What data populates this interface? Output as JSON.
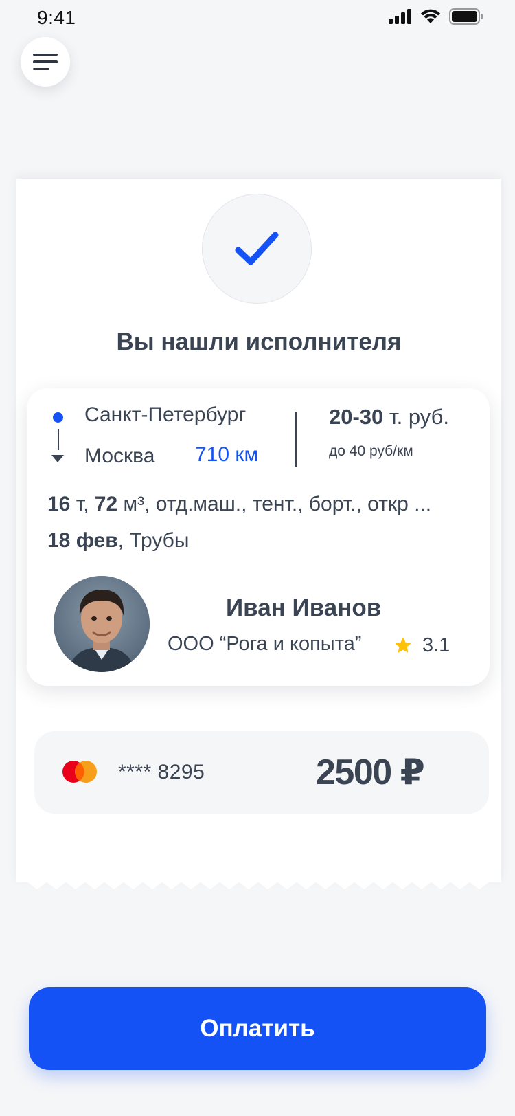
{
  "status_bar": {
    "time": "9:41"
  },
  "receipt": {
    "title": "Вы нашли исполнителя",
    "route": {
      "from": "Санкт-Петербург",
      "to": "Москва",
      "distance": "710 км"
    },
    "price": {
      "range": "20-30",
      "unit": " т. руб.",
      "per_km": "до 40 руб/км"
    },
    "cargo": {
      "weight": "16",
      "weight_unit": " т, ",
      "volume": "72",
      "volume_unit": " м³",
      "details": ", отд.маш., тент., борт., откр ...",
      "date": "18 фев",
      "type": ", Трубы"
    },
    "driver": {
      "name": "Иван Иванов",
      "company": "ООО “Рога и копыта”",
      "rating": "3.1"
    },
    "payment": {
      "card_number": "**** 8295",
      "amount": "2500 ₽"
    }
  },
  "actions": {
    "pay_label": "Оплатить"
  },
  "colors": {
    "accent": "#1452F5",
    "text": "#3B4453",
    "background": "#F5F6F8",
    "star": "#FFC107"
  }
}
